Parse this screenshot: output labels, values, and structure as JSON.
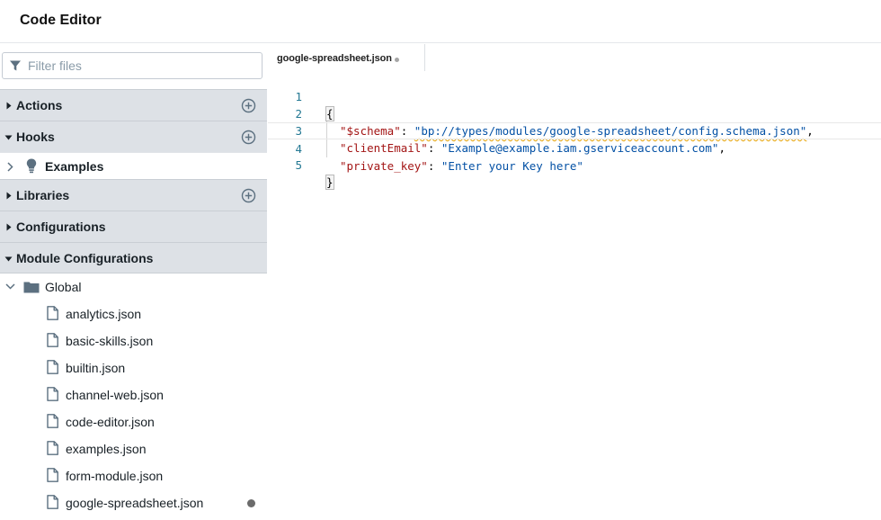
{
  "app": {
    "title": "Code Editor"
  },
  "sidebar": {
    "filter_placeholder": "Filter files",
    "sections": {
      "actions": "Actions",
      "hooks": "Hooks",
      "libraries": "Libraries",
      "configurations": "Configurations",
      "module_configurations": "Module Configurations"
    },
    "hooks_children": {
      "examples": "Examples"
    },
    "module_tree": {
      "folder": "Global",
      "files": [
        "analytics.json",
        "basic-skills.json",
        "builtin.json",
        "channel-web.json",
        "code-editor.json",
        "examples.json",
        "form-module.json",
        "google-spreadsheet.json"
      ]
    }
  },
  "editor": {
    "tab_label": "google-spreadsheet.json",
    "line_numbers": [
      "1",
      "2",
      "3",
      "4",
      "5"
    ],
    "open_brace": "{",
    "close_brace": "}",
    "entries": [
      {
        "key": "\"$schema\"",
        "value": "\"bp://types/modules/google-spreadsheet/config.schema.json\"",
        "trail": ","
      },
      {
        "key": "\"clientEmail\"",
        "value": "\"Example@example.iam.gserviceaccount.com\"",
        "trail": ","
      },
      {
        "key": "\"private_key\"",
        "value": "\"Enter your Key here\"",
        "trail": ""
      }
    ],
    "colon": ": "
  },
  "icons": {
    "filter": "funnel-icon",
    "add": "plus-circle-icon",
    "folder": "folder-icon",
    "file": "document-icon",
    "hook": "lightbulb-icon"
  },
  "colors": {
    "section_bg": "#dde1e6",
    "json_key": "#a31515",
    "json_string": "#0451a5",
    "line_number": "#237893",
    "unsaved_dot": "#6b6b6b"
  }
}
